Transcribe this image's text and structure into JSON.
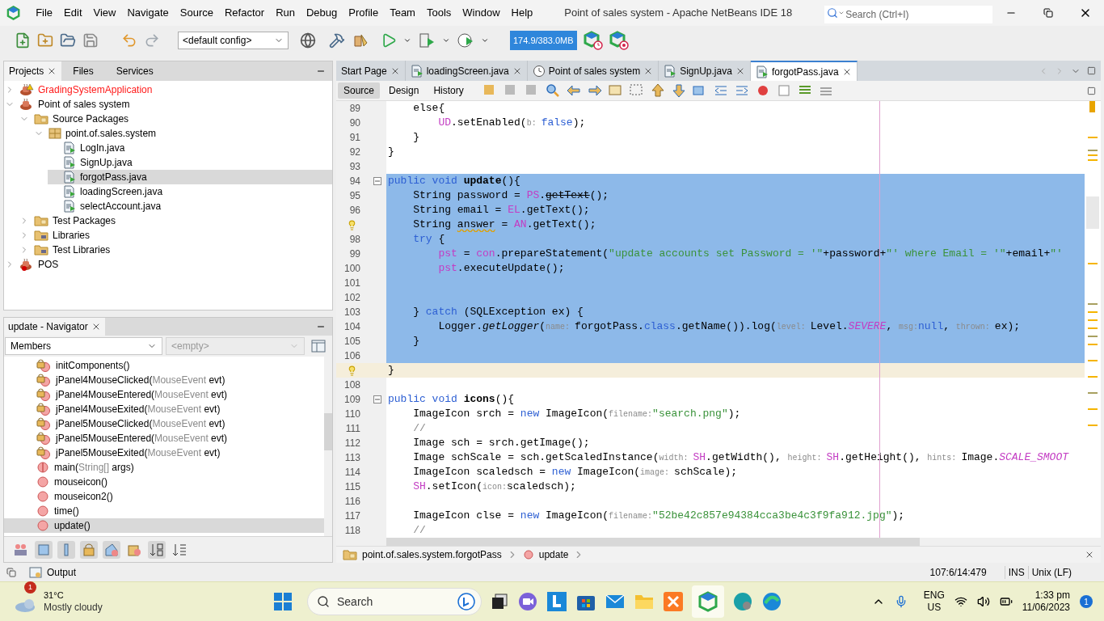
{
  "window": {
    "title": "Point of sales system - Apache NetBeans IDE 18",
    "search": {
      "placeholder": "Search (Ctrl+I)"
    }
  },
  "menu": [
    "File",
    "Edit",
    "View",
    "Navigate",
    "Source",
    "Refactor",
    "Run",
    "Debug",
    "Profile",
    "Team",
    "Tools",
    "Window",
    "Help"
  ],
  "toolbar": {
    "config": "<default config>",
    "memory": "174.9/383.0MB"
  },
  "projects_panel": {
    "tabs": [
      {
        "label": "Projects",
        "selected": true
      },
      {
        "label": "Files",
        "selected": false
      },
      {
        "label": "Services",
        "selected": false
      }
    ],
    "tree": [
      {
        "label": "GradingSystemApplication",
        "kind": "project-warning",
        "error": true,
        "expanded": false,
        "selected": false
      },
      {
        "label": "Point of sales system",
        "kind": "project",
        "error": false,
        "expanded": true,
        "selected": false,
        "children": [
          {
            "label": "Source Packages",
            "kind": "source-folder",
            "error": false,
            "expanded": true,
            "selected": false,
            "children": [
              {
                "label": "point.of.sales.system",
                "kind": "package",
                "error": false,
                "expanded": true,
                "selected": false,
                "children": [
                  {
                    "label": "LogIn.java",
                    "kind": "file",
                    "error": false,
                    "selected": false
                  },
                  {
                    "label": "SignUp.java",
                    "kind": "file",
                    "error": false,
                    "selected": false
                  },
                  {
                    "label": "forgotPass.java",
                    "kind": "file",
                    "error": false,
                    "selected": true
                  },
                  {
                    "label": "loadingScreen.java",
                    "kind": "file",
                    "error": false,
                    "selected": false
                  },
                  {
                    "label": "selectAccount.java",
                    "kind": "file",
                    "error": false,
                    "selected": false
                  }
                ]
              }
            ]
          },
          {
            "label": "Test Packages",
            "kind": "source-folder",
            "error": false,
            "expanded": false,
            "selected": false
          },
          {
            "label": "Libraries",
            "kind": "library-folder",
            "error": false,
            "expanded": false,
            "selected": false
          },
          {
            "label": "Test Libraries",
            "kind": "library-folder",
            "error": false,
            "expanded": false,
            "selected": false
          }
        ]
      },
      {
        "label": "POS",
        "kind": "project-broken",
        "error": false,
        "expanded": false,
        "selected": false
      }
    ]
  },
  "navigator": {
    "title": "update - Navigator",
    "filter": "Members",
    "second_filter": "<empty>",
    "members": [
      {
        "kind": "private-method",
        "name": "initComponents()",
        "selected": false
      },
      {
        "kind": "private-method",
        "name": "jPanel4MouseClicked(",
        "type": "MouseEvent",
        "rest": " evt)",
        "selected": false
      },
      {
        "kind": "private-method",
        "name": "jPanel4MouseEntered(",
        "type": "MouseEvent",
        "rest": " evt)",
        "selected": false
      },
      {
        "kind": "private-method",
        "name": "jPanel4MouseExited(",
        "type": "MouseEvent",
        "rest": " evt)",
        "selected": false
      },
      {
        "kind": "private-method",
        "name": "jPanel5MouseClicked(",
        "type": "MouseEvent",
        "rest": " evt)",
        "selected": false
      },
      {
        "kind": "private-method",
        "name": "jPanel5MouseEntered(",
        "type": "MouseEvent",
        "rest": " evt)",
        "selected": false
      },
      {
        "kind": "private-method",
        "name": "jPanel5MouseExited(",
        "type": "MouseEvent",
        "rest": " evt)",
        "selected": false
      },
      {
        "kind": "static-method",
        "name": "main(",
        "type": "String[]",
        "rest": " args)",
        "selected": false
      },
      {
        "kind": "method",
        "name": "mouseicon()",
        "selected": false
      },
      {
        "kind": "method",
        "name": "mouseicon2()",
        "selected": false
      },
      {
        "kind": "method",
        "name": "time()",
        "selected": false
      },
      {
        "kind": "method",
        "name": "update()",
        "selected": true
      }
    ]
  },
  "editor": {
    "tabs": [
      {
        "label": "Start Page",
        "kind": "page",
        "selected": false
      },
      {
        "label": "loadingScreen.java",
        "kind": "java",
        "selected": false
      },
      {
        "label": "Point of sales system",
        "kind": "profiler",
        "selected": false
      },
      {
        "label": "SignUp.java",
        "kind": "java",
        "selected": false
      },
      {
        "label": "forgotPass.java",
        "kind": "java",
        "selected": true
      }
    ],
    "modes": [
      {
        "label": "Source",
        "selected": true
      },
      {
        "label": "Design",
        "selected": false
      },
      {
        "label": "History",
        "selected": false
      }
    ],
    "lines": [
      {
        "num": "89",
        "bulb": false,
        "fold": false,
        "selected": false,
        "current": false,
        "tokens": [
          {
            "kind": "p",
            "text": "    else{"
          }
        ]
      },
      {
        "num": "90",
        "bulb": false,
        "fold": false,
        "selected": false,
        "current": false,
        "tokens": [
          {
            "kind": "f",
            "text": "        UD"
          },
          {
            "kind": "p",
            "text": ".setEnabled("
          },
          {
            "kind": "h",
            "text": "b: "
          },
          {
            "kind": "kw",
            "text": "false"
          },
          {
            "kind": "p",
            "text": ");"
          }
        ]
      },
      {
        "num": "91",
        "bulb": false,
        "fold": false,
        "selected": false,
        "current": false,
        "tokens": [
          {
            "kind": "p",
            "text": "    }"
          }
        ]
      },
      {
        "num": "92",
        "bulb": false,
        "fold": false,
        "selected": false,
        "current": false,
        "tokens": [
          {
            "kind": "p",
            "text": "}"
          }
        ]
      },
      {
        "num": "93",
        "bulb": false,
        "fold": false,
        "selected": false,
        "current": false
      },
      {
        "num": "94",
        "bulb": false,
        "fold": true,
        "selected": true,
        "current": false,
        "tokens": [
          {
            "kind": "kw",
            "text": "public void "
          },
          {
            "kind": "b",
            "text": "update"
          },
          {
            "kind": "p",
            "text": "(){"
          }
        ]
      },
      {
        "num": "95",
        "bulb": false,
        "fold": false,
        "selected": true,
        "current": false,
        "tokens": [
          {
            "kind": "p",
            "text": "    String password = "
          },
          {
            "kind": "f",
            "text": "PS"
          },
          {
            "kind": "p",
            "text": "."
          },
          {
            "kind": "x",
            "text": "getText"
          },
          {
            "kind": "p",
            "text": "();"
          }
        ]
      },
      {
        "num": "96",
        "bulb": false,
        "fold": false,
        "selected": true,
        "current": false,
        "tokens": [
          {
            "kind": "p",
            "text": "    String email = "
          },
          {
            "kind": "f",
            "text": "EL"
          },
          {
            "kind": "p",
            "text": ".getText();"
          }
        ]
      },
      {
        "bulb": true,
        "fold": false,
        "selected": true,
        "current": false,
        "tokens": [
          {
            "kind": "p",
            "text": "    String "
          },
          {
            "kind": "w",
            "text": "answer"
          },
          {
            "kind": "p",
            "text": " = "
          },
          {
            "kind": "f",
            "text": "AN"
          },
          {
            "kind": "p",
            "text": ".getText();"
          }
        ]
      },
      {
        "num": "98",
        "bulb": false,
        "fold": false,
        "selected": true,
        "current": false,
        "tokens": [
          {
            "kind": "kw",
            "text": "    try"
          },
          {
            "kind": "p",
            "text": " {"
          }
        ]
      },
      {
        "num": "99",
        "bulb": false,
        "fold": false,
        "selected": true,
        "current": false,
        "tokens": [
          {
            "kind": "f",
            "text": "        pst"
          },
          {
            "kind": "p",
            "text": " = "
          },
          {
            "kind": "f",
            "text": "con"
          },
          {
            "kind": "p",
            "text": ".prepareStatement("
          },
          {
            "kind": "s",
            "text": "\"update accounts set Password = '\""
          },
          {
            "kind": "p",
            "text": "+password+"
          },
          {
            "kind": "s",
            "text": "\"' where Email = '\""
          },
          {
            "kind": "p",
            "text": "+email+"
          },
          {
            "kind": "s",
            "text": "\"'"
          }
        ]
      },
      {
        "num": "100",
        "bulb": false,
        "fold": false,
        "selected": true,
        "current": false,
        "tokens": [
          {
            "kind": "f",
            "text": "        pst"
          },
          {
            "kind": "p",
            "text": ".executeUpdate();"
          }
        ]
      },
      {
        "num": "101",
        "bulb": false,
        "fold": false,
        "selected": true,
        "current": false
      },
      {
        "num": "102",
        "bulb": false,
        "fold": false,
        "selected": true,
        "current": false
      },
      {
        "num": "103",
        "bulb": false,
        "fold": false,
        "selected": true,
        "current": false,
        "tokens": [
          {
            "kind": "p",
            "text": "    } "
          },
          {
            "kind": "kw",
            "text": "catch"
          },
          {
            "kind": "p",
            "text": " (SQLException ex) {"
          }
        ]
      },
      {
        "num": "104",
        "bulb": false,
        "fold": false,
        "selected": true,
        "current": false,
        "tokens": [
          {
            "kind": "p",
            "text": "        Logger."
          },
          {
            "kind": "it",
            "text": "getLogger"
          },
          {
            "kind": "p",
            "text": "("
          },
          {
            "kind": "h",
            "text": "name: "
          },
          {
            "kind": "p",
            "text": "forgotPass."
          },
          {
            "kind": "kw",
            "text": "class"
          },
          {
            "kind": "p",
            "text": ".getName()).log("
          },
          {
            "kind": "h",
            "text": "level: "
          },
          {
            "kind": "p",
            "text": "Level."
          },
          {
            "kind": "i",
            "text": "SEVERE"
          },
          {
            "kind": "p",
            "text": ", "
          },
          {
            "kind": "h",
            "text": "msg:"
          },
          {
            "kind": "kw",
            "text": "null"
          },
          {
            "kind": "p",
            "text": ", "
          },
          {
            "kind": "h",
            "text": "thrown: "
          },
          {
            "kind": "p",
            "text": "ex);"
          }
        ]
      },
      {
        "num": "105",
        "bulb": false,
        "fold": false,
        "selected": true,
        "current": false,
        "tokens": [
          {
            "kind": "p",
            "text": "    }"
          }
        ]
      },
      {
        "num": "106",
        "bulb": false,
        "fold": false,
        "selected": true,
        "current": false
      },
      {
        "bulb": true,
        "fold": false,
        "selected": false,
        "current": true,
        "tokens": [
          {
            "kind": "p",
            "text": "}"
          }
        ]
      },
      {
        "num": "108",
        "bulb": false,
        "fold": false,
        "selected": false,
        "current": false
      },
      {
        "num": "109",
        "bulb": false,
        "fold": true,
        "selected": false,
        "current": false,
        "tokens": [
          {
            "kind": "kw",
            "text": "public void "
          },
          {
            "kind": "b",
            "text": "icons"
          },
          {
            "kind": "p",
            "text": "(){"
          }
        ]
      },
      {
        "num": "110",
        "bulb": false,
        "fold": false,
        "selected": false,
        "current": false,
        "tokens": [
          {
            "kind": "p",
            "text": "    ImageIcon srch = "
          },
          {
            "kind": "kw",
            "text": "new"
          },
          {
            "kind": "p",
            "text": " ImageIcon("
          },
          {
            "kind": "h",
            "text": "filename:"
          },
          {
            "kind": "s",
            "text": "\"search.png\""
          },
          {
            "kind": "p",
            "text": ");"
          }
        ]
      },
      {
        "num": "111",
        "bulb": false,
        "fold": false,
        "selected": false,
        "current": false,
        "tokens": [
          {
            "kind": "c",
            "text": "    //"
          }
        ]
      },
      {
        "num": "112",
        "bulb": false,
        "fold": false,
        "selected": false,
        "current": false,
        "tokens": [
          {
            "kind": "p",
            "text": "    Image sch = srch.getImage();"
          }
        ]
      },
      {
        "num": "113",
        "bulb": false,
        "fold": false,
        "selected": false,
        "current": false,
        "tokens": [
          {
            "kind": "p",
            "text": "    Image schScale = sch.getScaledInstance("
          },
          {
            "kind": "h",
            "text": "width: "
          },
          {
            "kind": "f",
            "text": "SH"
          },
          {
            "kind": "p",
            "text": ".getWidth(), "
          },
          {
            "kind": "h",
            "text": "height: "
          },
          {
            "kind": "f",
            "text": "SH"
          },
          {
            "kind": "p",
            "text": ".getHeight(), "
          },
          {
            "kind": "h",
            "text": "hints: "
          },
          {
            "kind": "p",
            "text": "Image."
          },
          {
            "kind": "i",
            "text": "SCALE_SMOOT"
          }
        ]
      },
      {
        "num": "114",
        "bulb": false,
        "fold": false,
        "selected": false,
        "current": false,
        "tokens": [
          {
            "kind": "p",
            "text": "    ImageIcon scaledsch = "
          },
          {
            "kind": "kw",
            "text": "new"
          },
          {
            "kind": "p",
            "text": " ImageIcon("
          },
          {
            "kind": "h",
            "text": "image: "
          },
          {
            "kind": "p",
            "text": "schScale);"
          }
        ]
      },
      {
        "num": "115",
        "bulb": false,
        "fold": false,
        "selected": false,
        "current": false,
        "tokens": [
          {
            "kind": "f",
            "text": "    SH"
          },
          {
            "kind": "p",
            "text": ".setIcon("
          },
          {
            "kind": "h",
            "text": "icon:"
          },
          {
            "kind": "p",
            "text": "scaledsch);"
          }
        ]
      },
      {
        "num": "116",
        "bulb": false,
        "fold": false,
        "selected": false,
        "current": false
      },
      {
        "num": "117",
        "bulb": false,
        "fold": false,
        "selected": false,
        "current": false,
        "tokens": [
          {
            "kind": "p",
            "text": "    ImageIcon clse = "
          },
          {
            "kind": "kw",
            "text": "new"
          },
          {
            "kind": "p",
            "text": " ImageIcon("
          },
          {
            "kind": "h",
            "text": "filename:"
          },
          {
            "kind": "s",
            "text": "\"52be42c857e94384cca3be4c3f9fa912.jpg\""
          },
          {
            "kind": "p",
            "text": ");"
          }
        ]
      },
      {
        "num": "118",
        "bulb": false,
        "fold": false,
        "selected": false,
        "current": false,
        "tokens": [
          {
            "kind": "c",
            "text": "    //"
          }
        ]
      }
    ],
    "breadcrumbs": [
      "point.of.sales.system.forgotPass",
      "update"
    ]
  },
  "status_bar": {
    "output": "Output",
    "position": "107:6/14:479",
    "mode": "INS",
    "line_ending": "Unix (LF)"
  },
  "taskbar": {
    "weather": {
      "temperature": "31°C",
      "condition": "Mostly cloudy",
      "badge": "1"
    },
    "search": {
      "placeholder": "Search"
    },
    "language": "ENG",
    "region": "US",
    "time": "1:33 pm",
    "date": "11/06/2023",
    "notifications": "1"
  }
}
